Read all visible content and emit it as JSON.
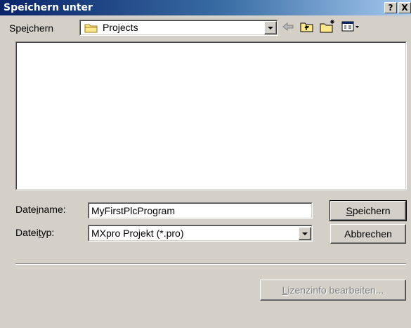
{
  "dialog": {
    "title": "Speichern unter",
    "help_label": "?",
    "close_label": "X"
  },
  "location": {
    "label_pre": "Spe",
    "label_accel": "i",
    "label_post": "chern",
    "value": "Projects"
  },
  "toolbar": {
    "icons": [
      "back-arrow-icon",
      "up-folder-icon",
      "new-folder-icon",
      "view-menu-icon"
    ]
  },
  "file_list": {
    "items": []
  },
  "filename": {
    "label_pre": "Date",
    "label_accel": "i",
    "label_post": "name:",
    "value": "MyFirstPlcProgram"
  },
  "filetype": {
    "label_pre": "Datei",
    "label_accel": "t",
    "label_post": "yp:",
    "value": "MXpro Projekt (*.pro)"
  },
  "buttons": {
    "save_accel": "S",
    "save_post": "peichern",
    "cancel": "Abbrechen",
    "license_accel": "L",
    "license_post": "izenzinfo bearbeiten..."
  }
}
